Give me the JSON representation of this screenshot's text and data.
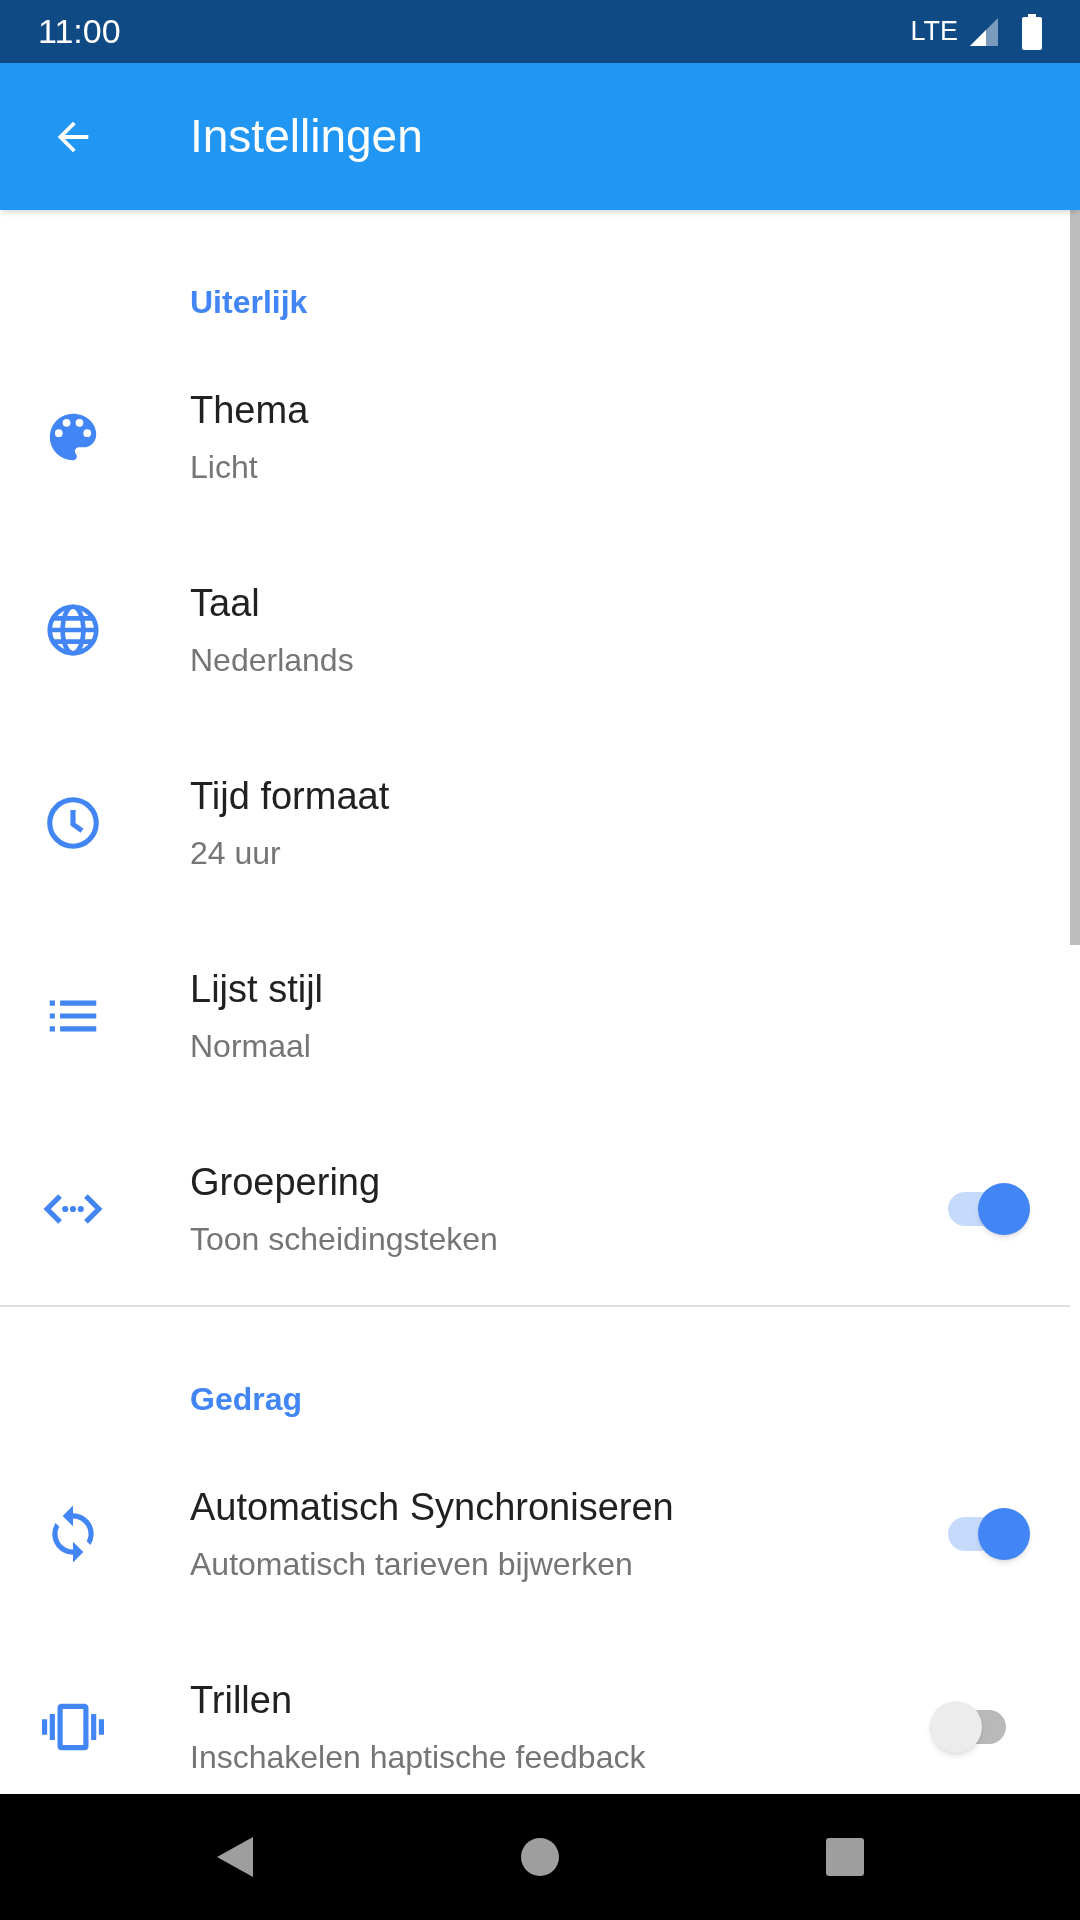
{
  "status_bar": {
    "time": "11:00",
    "network": "LTE"
  },
  "app_bar": {
    "title": "Instellingen"
  },
  "sections": [
    {
      "header": "Uiterlijk",
      "items": [
        {
          "kind": "value",
          "title": "Thema",
          "subtitle": "Licht"
        },
        {
          "kind": "value",
          "title": "Taal",
          "subtitle": "Nederlands"
        },
        {
          "kind": "value",
          "title": "Tijd formaat",
          "subtitle": "24 uur"
        },
        {
          "kind": "value",
          "title": "Lijst stijl",
          "subtitle": "Normaal"
        },
        {
          "kind": "toggle",
          "title": "Groepering",
          "subtitle": "Toon scheidingsteken",
          "on": true
        }
      ]
    },
    {
      "header": "Gedrag",
      "items": [
        {
          "kind": "toggle",
          "title": "Automatisch Synchroniseren",
          "subtitle": "Automatisch tarieven bijwerken",
          "on": true
        },
        {
          "kind": "toggle",
          "title": "Trillen",
          "subtitle": "Inschakelen haptische feedback",
          "on": false
        }
      ]
    }
  ]
}
